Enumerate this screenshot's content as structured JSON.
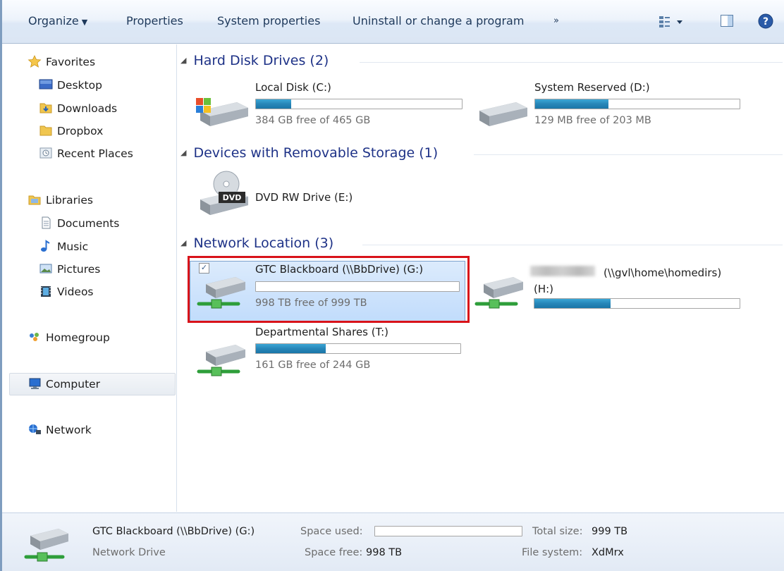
{
  "toolbar": {
    "organize": "Organize",
    "properties": "Properties",
    "system_properties": "System properties",
    "uninstall": "Uninstall or change a program",
    "more": "»"
  },
  "sidebar": {
    "favorites": "Favorites",
    "favorites_items": [
      "Desktop",
      "Downloads",
      "Dropbox",
      "Recent Places"
    ],
    "libraries": "Libraries",
    "libraries_items": [
      "Documents",
      "Music",
      "Pictures",
      "Videos"
    ],
    "homegroup": "Homegroup",
    "computer": "Computer",
    "network": "Network"
  },
  "groups": {
    "hard_disk": "Hard Disk Drives (2)",
    "removable": "Devices with Removable Storage (1)",
    "network": "Network Location (3)"
  },
  "drives": {
    "c": {
      "name": "Local Disk (C:)",
      "space": "384 GB free of 465 GB",
      "used_fraction": 0.17
    },
    "d": {
      "name": "System Reserved (D:)",
      "space": "129 MB free of 203 MB",
      "used_fraction": 0.36
    },
    "e": {
      "name": "DVD RW Drive (E:)",
      "dvd_label": "DVD"
    },
    "g": {
      "name": "GTC Blackboard (\\\\BbDrive) (G:)",
      "space": "998 TB free of 999 TB",
      "used_fraction": 0.0
    },
    "h": {
      "name_suffix": "(\\\\gvl\\home\\homedirs)",
      "letter": "(H:)",
      "used_fraction": 0.37
    },
    "t": {
      "name": "Departmental Shares (T:)",
      "space": "161 GB free of 244 GB",
      "used_fraction": 0.34
    }
  },
  "details": {
    "name": "GTC Blackboard (\\\\BbDrive) (G:)",
    "type": "Network Drive",
    "space_used_label": "Space used:",
    "space_free_label": "Space free:",
    "space_free_value": "998 TB",
    "total_size_label": "Total size:",
    "total_size_value": "999 TB",
    "file_system_label": "File system:",
    "file_system_value": "XdMrx",
    "used_fraction": 0.0
  },
  "colors": {
    "accent": "#1e3287",
    "bar_fill": "#2786b8",
    "highlight": "#d9131a"
  }
}
